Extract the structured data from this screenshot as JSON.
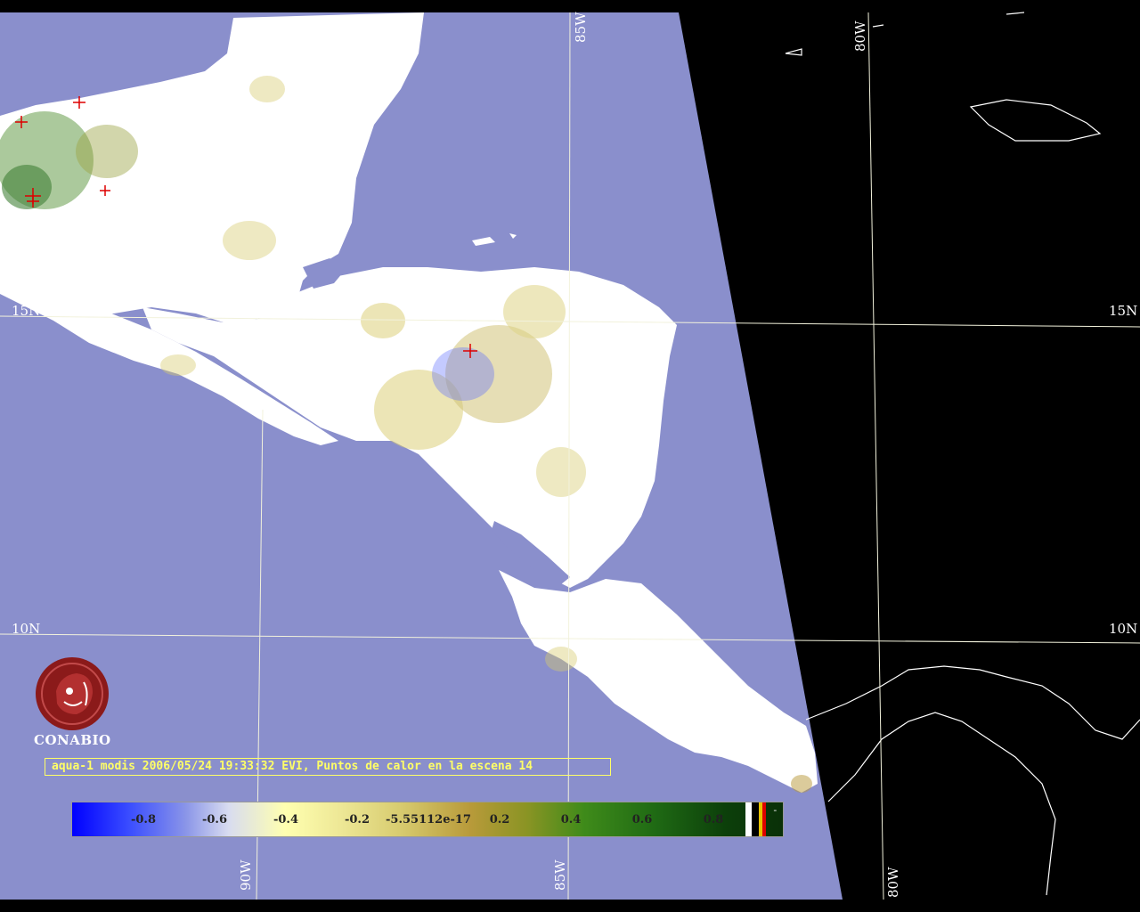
{
  "caption": "aqua-1 modis 2006/05/24 19:33:32 EVI, Puntos de calor en la escena 14",
  "logo": {
    "text": "CONABIO",
    "icon": "conabio-logo-icon"
  },
  "colorbar": {
    "ticks": [
      "-0.8",
      "-0.6",
      "-0.4",
      "-0.2",
      "-5.55112e-17",
      "0.2",
      "0.4",
      "0.6",
      "0.8"
    ],
    "special": "-",
    "colors": {
      "low": "#0000ff",
      "mid": "#ffffb0",
      "high": "#0a3008",
      "nodata": "#ffffff",
      "fire": "#dd0000"
    }
  },
  "graticule": {
    "lat_labels": [
      "15N",
      "15N",
      "10N",
      "10N"
    ],
    "lon_labels": [
      "85W",
      "80W",
      "90W",
      "85W",
      "80W"
    ]
  },
  "colors": {
    "ocean": "#8a8fcc",
    "land": "#ffffff",
    "outside": "#000000",
    "grid": "#f2f2dc",
    "caption": "#ffff66"
  }
}
